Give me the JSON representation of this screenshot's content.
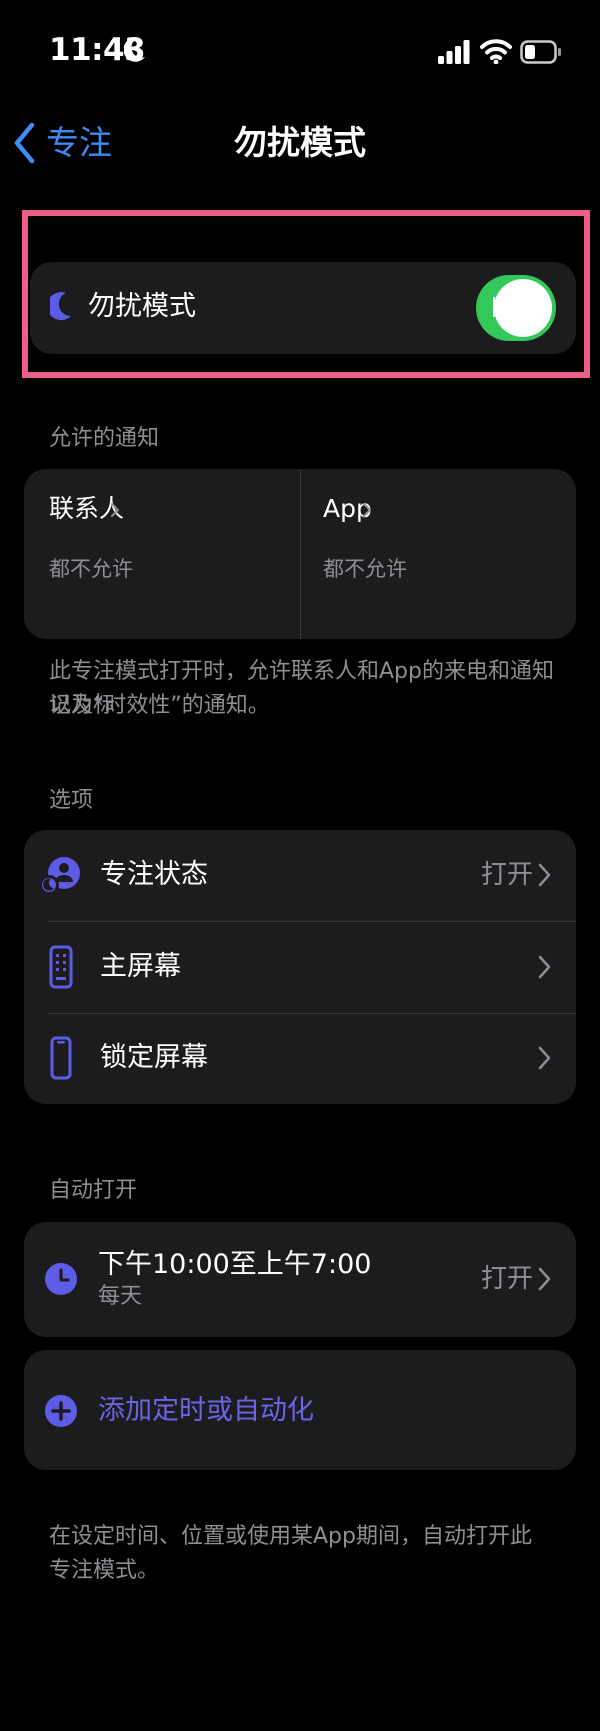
{
  "status_bar": {
    "time": "11:43"
  },
  "nav": {
    "back_label": "专注",
    "title": "勿扰模式"
  },
  "dnd": {
    "label": "勿扰模式",
    "enabled": true
  },
  "allowed_notifications": {
    "header": "允许的通知",
    "contacts": {
      "title": "联系人",
      "value": "都不允许"
    },
    "apps": {
      "title": "App",
      "value": "都不允许"
    },
    "footnote_line1": "此专注模式打开时，允许联系人和App的来电和通知以及标",
    "footnote_line2": "记为“时效性”的通知。"
  },
  "options": {
    "header": "选项",
    "items": [
      {
        "label": "专注状态",
        "value": "打开",
        "icon": "focus-status-icon"
      },
      {
        "label": "主屏幕",
        "value": "",
        "icon": "home-screen-icon"
      },
      {
        "label": "锁定屏幕",
        "value": "",
        "icon": "lock-screen-icon"
      }
    ]
  },
  "auto_on": {
    "header": "自动打开",
    "schedule": {
      "title": "下午10:00至上午7:00",
      "subtitle": "每天",
      "value": "打开"
    },
    "add_label": "添加定时或自动化",
    "footnote_line1": "在设定时间、位置或使用某App期间，自动打开此",
    "footnote_line2": "专注模式。"
  },
  "colors": {
    "accent_blue": "#3d8df5",
    "accent_purple": "#5e5ce6",
    "toggle_green": "#34c759",
    "highlight_pink": "#ec5f8b"
  }
}
